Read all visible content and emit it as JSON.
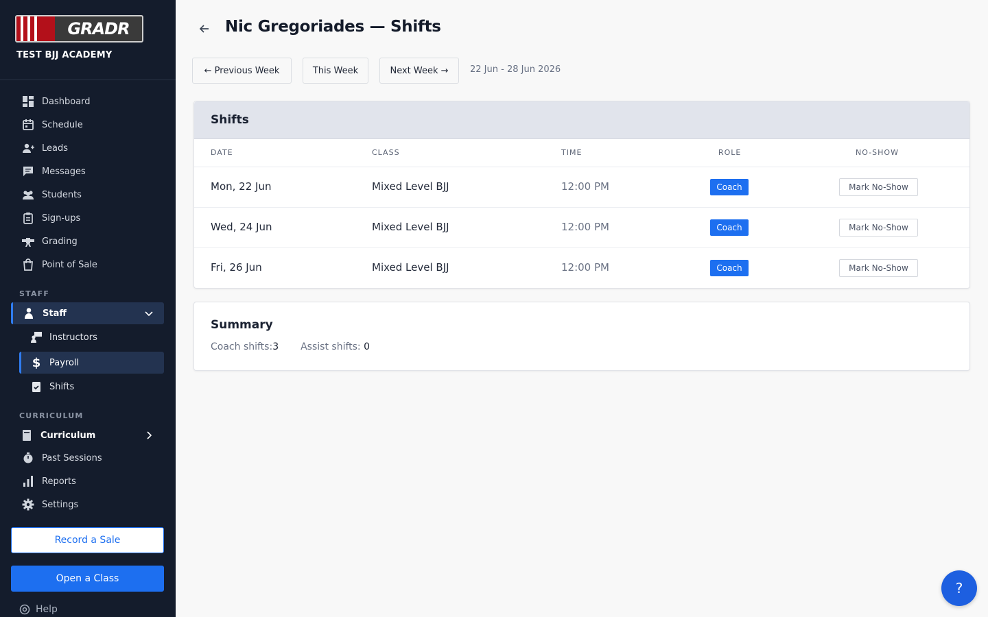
{
  "sidebar": {
    "logo_text": "GRADR",
    "academy": "TEST BJJ ACADEMY",
    "nav": [
      {
        "label": "Dashboard",
        "icon": "dashboard-icon"
      },
      {
        "label": "Schedule",
        "icon": "calendar-icon"
      },
      {
        "label": "Leads",
        "icon": "add-person-icon"
      },
      {
        "label": "Messages",
        "icon": "chat-icon"
      },
      {
        "label": "Students",
        "icon": "students-icon"
      },
      {
        "label": "Sign-ups",
        "icon": "clipboard-icon"
      },
      {
        "label": "Grading",
        "icon": "belt-icon"
      },
      {
        "label": "Point of Sale",
        "icon": "bag-icon"
      }
    ],
    "staff_section": "STAFF",
    "staff_group": "Staff",
    "staff_items": [
      {
        "label": "Instructors"
      },
      {
        "label": "Payroll"
      },
      {
        "label": "Shifts"
      }
    ],
    "curriculum_section": "CURRICULUM",
    "curriculum_group": "Curriculum",
    "more_nav": [
      {
        "label": "Past Sessions"
      },
      {
        "label": "Reports"
      },
      {
        "label": "Settings"
      }
    ],
    "record_sale": "Record a Sale",
    "open_class": "Open a Class",
    "help": "Help"
  },
  "header": {
    "title": "Nic Gregoriades — Shifts",
    "prev_week": "← Previous Week",
    "this_week": "This Week",
    "next_week": "Next Week →",
    "range": "22 Jun - 28 Jun 2026"
  },
  "shifts": {
    "title": "Shifts",
    "columns": {
      "date": "DATE",
      "class": "CLASS",
      "time": "TIME",
      "role": "ROLE",
      "noshow": "NO-SHOW"
    },
    "rows": [
      {
        "date": "Mon, 22 Jun",
        "class": "Mixed Level BJJ",
        "time": "12:00 PM",
        "role": "Coach",
        "action": "Mark No-Show"
      },
      {
        "date": "Wed, 24 Jun",
        "class": "Mixed Level BJJ",
        "time": "12:00 PM",
        "role": "Coach",
        "action": "Mark No-Show"
      },
      {
        "date": "Fri, 26 Jun",
        "class": "Mixed Level BJJ",
        "time": "12:00 PM",
        "role": "Coach",
        "action": "Mark No-Show"
      }
    ]
  },
  "summary": {
    "title": "Summary",
    "coach_label": "Coach shifts:",
    "coach_value": "3",
    "assist_label": "Assist shifts:",
    "assist_value": "0"
  },
  "fab": "?",
  "colors": {
    "sidebar_bg": "#141c2c",
    "accent": "#1d6ff0",
    "active_row": "#233350"
  }
}
